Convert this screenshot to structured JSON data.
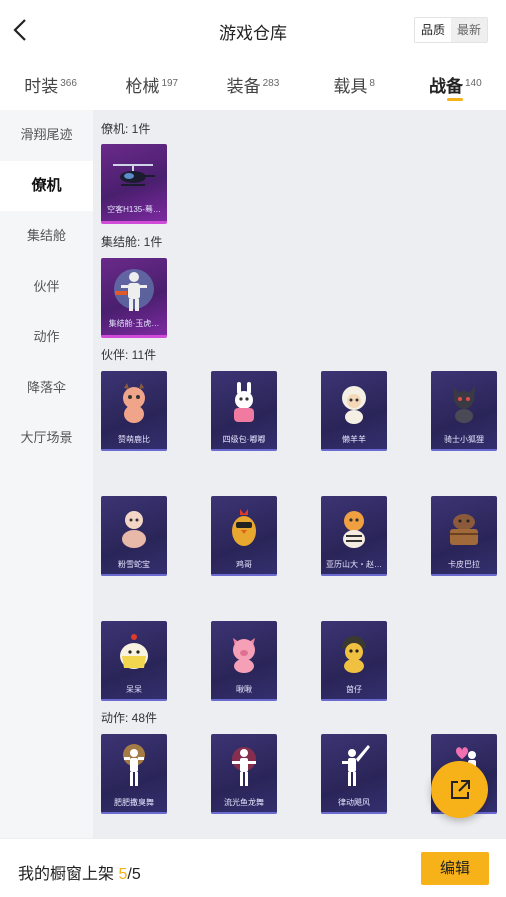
{
  "header": {
    "title": "游戏仓库",
    "sort_quality": "品质",
    "sort_newest": "最新"
  },
  "tabs": [
    {
      "label": "时装",
      "count": "366"
    },
    {
      "label": "枪械",
      "count": "197"
    },
    {
      "label": "装备",
      "count": "283"
    },
    {
      "label": "载具",
      "count": "8"
    },
    {
      "label": "战备",
      "count": "140"
    }
  ],
  "active_tab": "战备",
  "sidebar": {
    "items": [
      "滑翔尾迹",
      "僚机",
      "集结舱",
      "伙伴",
      "动作",
      "降落伞",
      "大厅场景"
    ],
    "active": "僚机"
  },
  "sections": {
    "wingman": {
      "title": "僚机: 1件",
      "items": [
        "空客H135-蓦…"
      ]
    },
    "pod": {
      "title": "集结舱: 1件",
      "items": [
        "集结舱·玉虎…"
      ]
    },
    "partner": {
      "title": "伙伴: 11件",
      "items": [
        "赞萌鹿比",
        "四级包·嘟嘟",
        "懒羊羊",
        "骑士小狐狸",
        "粉雪蛇宝",
        "鸡哥",
        "亚历山大・赵…",
        "卡皮巴拉",
        "呆呆",
        "啾啾",
        "茵仔"
      ]
    },
    "action": {
      "title": "动作: 48件",
      "items": [
        "肥肥撒臭舞",
        "流光鱼龙舞",
        "律动飓风",
        ""
      ]
    }
  },
  "bottom": {
    "label": "我的橱窗上架 ",
    "current": "5",
    "sep": "/",
    "total": "5",
    "edit": "编辑"
  },
  "colors": {
    "accent": "#f7b219",
    "card_blue": "#2a2558",
    "card_purple": "#6a2a8a"
  }
}
